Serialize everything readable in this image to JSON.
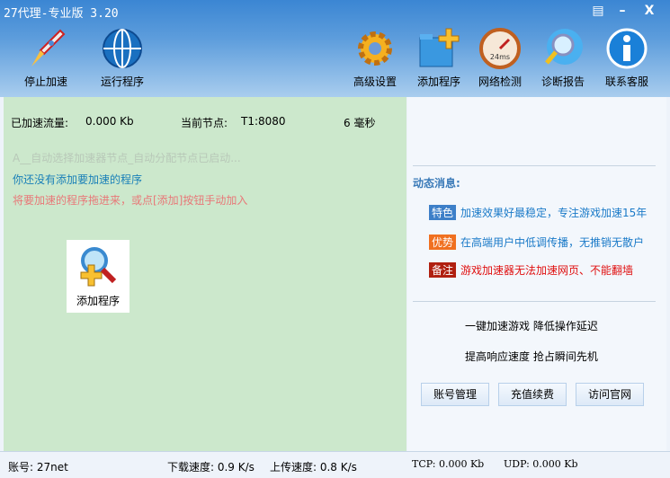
{
  "window": {
    "title": "27代理-专业版 3.20"
  },
  "toolbar": {
    "stop": "停止加速",
    "run": "运行程序",
    "settings": "高级设置",
    "add": "添加程序",
    "network": "网络检测",
    "diagnose": "诊断报告",
    "support": "联系客服",
    "ping_badge": "24ms"
  },
  "stats": {
    "traffic_label": "已加速流量:",
    "traffic_value": "0.000 Kb",
    "node_label": "当前节点:",
    "node_value": "T1:8080",
    "latency": "6 毫秒"
  },
  "messages": {
    "auto": "A__自动选择加速器节点_自动分配节点已启动...",
    "none": "你还没有添加要加速的程序",
    "hint": "将要加速的程序拖进来，或点[添加]按钮手动加入"
  },
  "add_program": {
    "label": "添加程序"
  },
  "news": {
    "title": "动态消息:",
    "items": [
      {
        "tag": "特色",
        "text": "加速效果好最稳定，专注游戏加速15年",
        "tag_color": "#3d7fc8",
        "text_color": "#1a7ac8"
      },
      {
        "tag": "优势",
        "text": "在高端用户中低调传播，无推销无散户",
        "tag_color": "#f07020",
        "text_color": "#1a7ac8"
      },
      {
        "tag": "备注",
        "text": "游戏加速器无法加速网页、不能翻墙",
        "tag_color": "#b02010",
        "text_color": "#e01010"
      }
    ]
  },
  "slogans": [
    "一键加速游戏 降低操作延迟",
    "提高响应速度 抢占瞬间先机"
  ],
  "buttons": {
    "account": "账号管理",
    "recharge": "充值续费",
    "website": "访问官网"
  },
  "status": {
    "account": "账号: 27net",
    "download": "下载速度: 0.9 K/s",
    "upload": "上传速度: 0.8 K/s",
    "tcp": "TCP: 0.000 Kb",
    "udp": "UDP: 0.000 Kb"
  }
}
